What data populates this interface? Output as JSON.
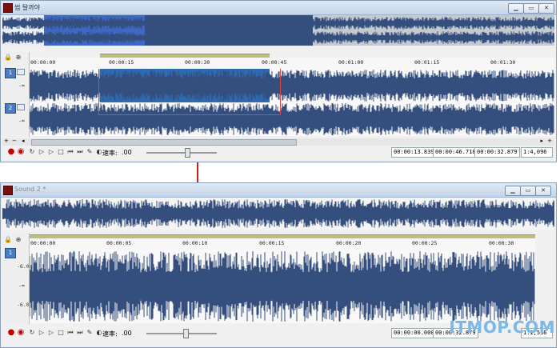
{
  "window1": {
    "title": "썹 탈까야",
    "ruler_labels": [
      "00:00:00",
      "00:00:15",
      "00:00:30",
      "00:00:45",
      "00:01:00",
      "00:01:15",
      "00:01:30"
    ],
    "channels": [
      "1",
      "2"
    ],
    "db_labels": [
      "-∞",
      "-∞"
    ],
    "rate_label": "速率:",
    "rate_value": ".00",
    "time_start": "00:00:13.839",
    "time_end": "00:00:46.718",
    "time_length": "00:00:32.879",
    "zoom": "1:4,096",
    "wave_color": "#344e7e",
    "selection_color": "#2e6ab0"
  },
  "window2": {
    "title": "Sound 2 *",
    "ruler_labels": [
      "00:00:00",
      "00:00:05",
      "00:00:10",
      "00:00:15",
      "00:00:20",
      "00:00:25",
      "00:00:30"
    ],
    "channels": [
      "1"
    ],
    "db_labels": [
      "-6.0",
      "-∞",
      "-6.0"
    ],
    "rate_label": "速率:",
    "rate_value": ".00",
    "time_start": "00:00:00.000",
    "time_end": "00:00:32.879",
    "zoom": "1:1,536"
  },
  "window_buttons": [
    "minimize-icon",
    "restore-icon",
    "close-icon"
  ],
  "watermark": "ITMOP.COM"
}
